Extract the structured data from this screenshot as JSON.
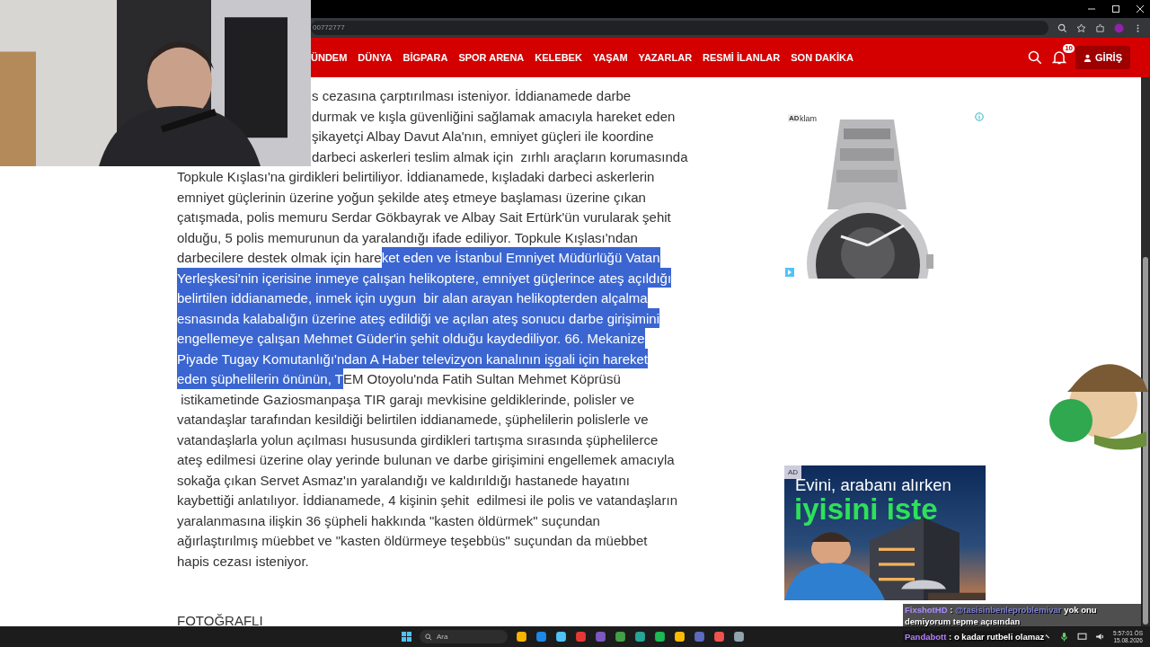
{
  "browser": {
    "url": "00772777"
  },
  "nav": {
    "items": [
      "ÜNDEM",
      "DÜNYA",
      "BİGPARA",
      "SPOR ARENA",
      "KELEBEK",
      "YAŞAM",
      "YAZARLAR",
      "RESMİ İLANLAR",
      "SON DAKİKA"
    ],
    "notification_count": "10",
    "login_button": "GİRİŞ"
  },
  "article": {
    "lines": [
      {
        "partial": true,
        "segments": [
          {
            "text": "s cezasına çarptırılması isteniyor. İddianamede darbe",
            "selected": false
          }
        ]
      },
      {
        "partial": true,
        "segments": [
          {
            "text": "durmak ve kışla güvenliğini sağlamak amacıyla hareket eden",
            "selected": false
          }
        ]
      },
      {
        "partial": true,
        "segments": [
          {
            "text": "şikayetçi Albay Davut Ala'nın, emniyet güçleri ile koordine",
            "selected": false
          }
        ]
      },
      {
        "partial": true,
        "segments": [
          {
            "text": "darbeci askerleri teslim almak için  zırhlı araçların korumasında",
            "selected": false
          }
        ]
      },
      {
        "partial": false,
        "segments": [
          {
            "text": "Topkule Kışlası'na girdikleri belirtiliyor. İddianamede, kışladaki darbeci askerlerin",
            "selected": false
          }
        ]
      },
      {
        "partial": false,
        "segments": [
          {
            "text": "emniyet güçlerinin üzerine yoğun şekilde ateş etmeye başlaması üzerine çıkan",
            "selected": false
          }
        ]
      },
      {
        "partial": false,
        "segments": [
          {
            "text": "çatışmada, polis memuru Serdar Gökbayrak ve Albay Sait Ertürk'ün vurularak şehit",
            "selected": false
          }
        ]
      },
      {
        "partial": false,
        "segments": [
          {
            "text": "olduğu, 5 polis memurunun da yaralandığı ifade ediliyor. Topkule Kışlası'ndan",
            "selected": false
          }
        ]
      },
      {
        "partial": false,
        "segments": [
          {
            "text": "darbecilere destek olmak için hare",
            "selected": false
          },
          {
            "text": "ket eden ve İstanbul Emniyet Müdürlüğü Vatan",
            "selected": true
          }
        ]
      },
      {
        "partial": false,
        "segments": [
          {
            "text": "Yerleşkesi'nin içerisine inmeye çalışan helikoptere, emniyet güçlerince ateş açıldığı",
            "selected": true
          }
        ]
      },
      {
        "partial": false,
        "segments": [
          {
            "text": "belirtilen iddianamede, inmek için uygun  bir alan arayan helikopterden alçalma",
            "selected": true
          }
        ]
      },
      {
        "partial": false,
        "segments": [
          {
            "text": "esnasında kalabalığın üzerine ateş edildiği ve açılan ateş sonucu darbe girişimini",
            "selected": true
          }
        ]
      },
      {
        "partial": false,
        "segments": [
          {
            "text": "engellemeye çalışan Mehmet Güder'in şehit olduğu kaydediliyor. 66. Mekanize",
            "selected": true
          }
        ]
      },
      {
        "partial": false,
        "segments": [
          {
            "text": "Piyade Tugay Komutanlığı'ndan A Haber televizyon kanalının işgali için hareket",
            "selected": true
          }
        ]
      },
      {
        "partial": false,
        "segments": [
          {
            "text": "eden şüphelilerin önünün, T",
            "selected": true
          },
          {
            "text": "EM Otoyolu'nda Fatih Sultan Mehmet Köprüsü",
            "selected": false
          }
        ]
      },
      {
        "partial": false,
        "segments": [
          {
            "text": " istikametinde Gaziosmanpaşa TIR garajı mevkisine geldiklerinde, polisler ve",
            "selected": false
          }
        ]
      },
      {
        "partial": false,
        "segments": [
          {
            "text": "vatandaşlar tarafından kesildiği belirtilen iddianamede, şüphelilerin polislerle ve",
            "selected": false
          }
        ]
      },
      {
        "partial": false,
        "segments": [
          {
            "text": "vatandaşlarla yolun açılması hususunda girdikleri tartışma sırasında şüphelilerce",
            "selected": false
          }
        ]
      },
      {
        "partial": false,
        "segments": [
          {
            "text": "ateş edilmesi üzerine olay yerinde bulunan ve darbe girişimini engellemek amacıyla",
            "selected": false
          }
        ]
      },
      {
        "partial": false,
        "segments": [
          {
            "text": "sokağa çıkan Servet Asmaz'ın yaralandığı ve kaldırıldığı hastanede hayatını",
            "selected": false
          }
        ]
      },
      {
        "partial": false,
        "segments": [
          {
            "text": "kaybettiği anlatılıyor. İddianamede, 4 kişinin şehit  edilmesi ile polis ve vatandaşların",
            "selected": false
          }
        ]
      },
      {
        "partial": false,
        "segments": [
          {
            "text": "yaralanmasına ilişkin 36 şüpheli hakkında \"kasten öldürmek\" suçundan",
            "selected": false
          }
        ]
      },
      {
        "partial": false,
        "segments": [
          {
            "text": "ağırlaştırılmış müebbet ve \"kasten öldürmeye teşebbüs\" suçundan da müebbet",
            "selected": false
          }
        ]
      },
      {
        "partial": false,
        "segments": [
          {
            "text": "hapis cezası isteniyor.",
            "selected": false
          }
        ]
      }
    ],
    "section_heading": "FOTOĞRAFLI"
  },
  "ads": [
    {
      "kind": "product",
      "badge": "AD",
      "label": "klam"
    },
    {
      "kind": "banner",
      "badge": "AD",
      "headline": "Evini, arabanı alırken",
      "slogan": "iyisini iste"
    }
  ],
  "chat": [
    {
      "user": "FixshotHD",
      "color": "#a98cff",
      "separator": ":",
      "mention": "@tasisinbenleproblemivar",
      "message": "yok onu demiyorum tepme açısından"
    },
    {
      "user": "Pandabott",
      "color": "#b77cff",
      "separator": ":",
      "message": "o kadar rutbeli olamaz"
    }
  ],
  "taskbar": {
    "search_placeholder": "Ara",
    "time": "5:57:01 ÖS",
    "date": "15.08.2026"
  }
}
